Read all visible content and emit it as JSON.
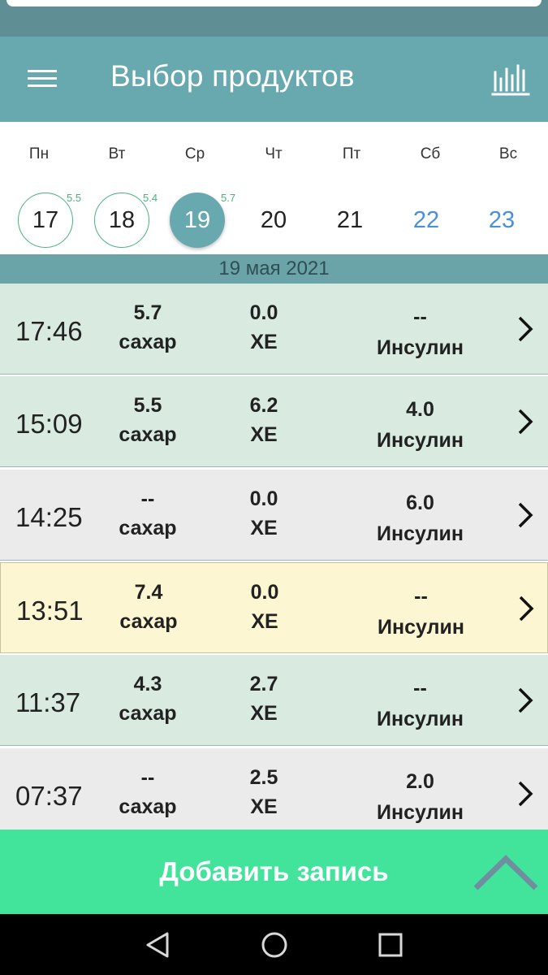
{
  "header": {
    "title": "Выбор продуктов",
    "menu_icon": "hamburger-menu-icon",
    "stats_icon": "bar-chart-icon"
  },
  "calendar": {
    "weekdays": [
      "Пн",
      "Вт",
      "Ср",
      "Чт",
      "Пт",
      "Сб",
      "Вс"
    ],
    "days": [
      {
        "number": "17",
        "badge": "5.5",
        "has_record": true,
        "selected": false,
        "weekend": false
      },
      {
        "number": "18",
        "badge": "5.4",
        "has_record": true,
        "selected": false,
        "weekend": false
      },
      {
        "number": "19",
        "badge": "5.7",
        "has_record": true,
        "selected": true,
        "weekend": false
      },
      {
        "number": "20",
        "badge": "",
        "has_record": false,
        "selected": false,
        "weekend": false
      },
      {
        "number": "21",
        "badge": "",
        "has_record": false,
        "selected": false,
        "weekend": false
      },
      {
        "number": "22",
        "badge": "",
        "has_record": false,
        "selected": false,
        "weekend": true
      },
      {
        "number": "23",
        "badge": "",
        "has_record": false,
        "selected": false,
        "weekend": true
      }
    ]
  },
  "date_label": "19 мая 2021",
  "records": [
    {
      "time": "17:46",
      "sugar": "5.7",
      "sugar_label": "сахар",
      "xe": "0.0",
      "xe_label": "ХЕ",
      "insulin": "--",
      "insulin_label": "Инсулин",
      "tone": "green"
    },
    {
      "time": "15:09",
      "sugar": "5.5",
      "sugar_label": "сахар",
      "xe": "6.2",
      "xe_label": "ХЕ",
      "insulin": "4.0",
      "insulin_label": "Инсулин",
      "tone": "green"
    },
    {
      "time": "14:25",
      "sugar": "--",
      "sugar_label": "сахар",
      "xe": "0.0",
      "xe_label": "ХЕ",
      "insulin": "6.0",
      "insulin_label": "Инсулин",
      "tone": "grey"
    },
    {
      "time": "13:51",
      "sugar": "7.4",
      "sugar_label": "сахар",
      "xe": "0.0",
      "xe_label": "ХЕ",
      "insulin": "--",
      "insulin_label": "Инсулин",
      "tone": "yellow"
    },
    {
      "time": "11:37",
      "sugar": "4.3",
      "sugar_label": "сахар",
      "xe": "2.7",
      "xe_label": "ХЕ",
      "insulin": "--",
      "insulin_label": "Инсулин",
      "tone": "green"
    },
    {
      "time": "07:37",
      "sugar": "--",
      "sugar_label": "сахар",
      "xe": "2.5",
      "xe_label": "ХЕ",
      "insulin": "2.0",
      "insulin_label": "Инсулин",
      "tone": "grey"
    }
  ],
  "add_button": {
    "label": "Добавить запись"
  },
  "colors": {
    "header": "#67a9ae",
    "accent_green": "#42e39b",
    "badge_green": "#4caf7d",
    "weekend_blue": "#4a90d9",
    "row_green": "#d9ebe1",
    "row_grey": "#ebebeb",
    "row_yellow": "#fdf6d2"
  },
  "nav": {
    "back_icon": "back-triangle-icon",
    "home_icon": "home-circle-icon",
    "recents_icon": "recents-square-icon"
  }
}
